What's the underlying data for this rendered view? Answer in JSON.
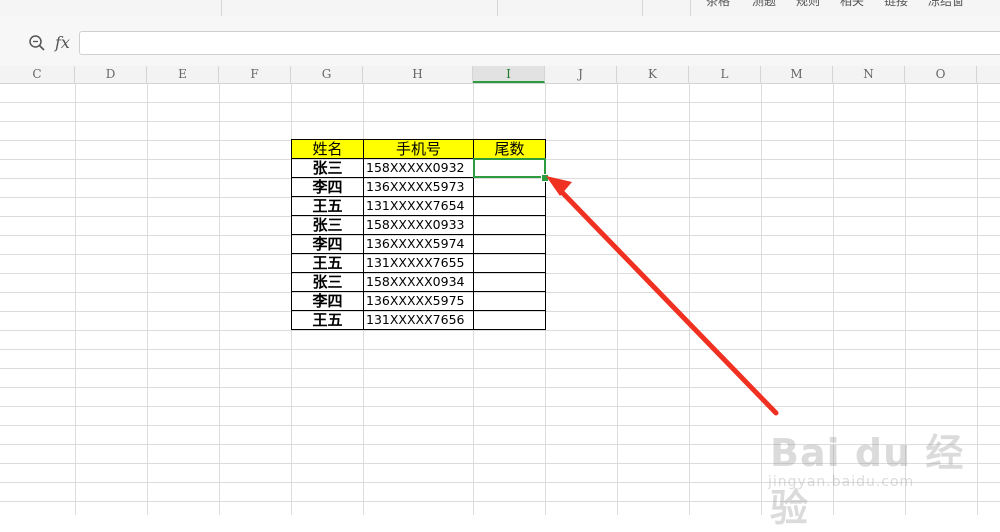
{
  "toolbar": {
    "items": [
      "茶格",
      "测题",
      "规则",
      "相关",
      "链接",
      "冻结窗"
    ]
  },
  "formula_bar": {
    "fx_label": "fx",
    "value": ""
  },
  "columns": [
    "C",
    "D",
    "E",
    "F",
    "G",
    "H",
    "I",
    "J",
    "K",
    "L",
    "M",
    "N",
    "O"
  ],
  "active_column": "I",
  "table": {
    "headers": [
      "姓名",
      "手机号",
      "尾数"
    ],
    "rows": [
      {
        "name": "张三",
        "phone": "158XXXXX0932",
        "tail": ""
      },
      {
        "name": "李四",
        "phone": "136XXXXX5973",
        "tail": ""
      },
      {
        "name": "王五",
        "phone": "131XXXXX7654",
        "tail": ""
      },
      {
        "name": "张三",
        "phone": "158XXXXX0933",
        "tail": ""
      },
      {
        "name": "李四",
        "phone": "136XXXXX5974",
        "tail": ""
      },
      {
        "name": "王五",
        "phone": "131XXXXX7655",
        "tail": ""
      },
      {
        "name": "张三",
        "phone": "158XXXXX0934",
        "tail": ""
      },
      {
        "name": "李四",
        "phone": "136XXXXX5975",
        "tail": ""
      },
      {
        "name": "王五",
        "phone": "131XXXXX7656",
        "tail": ""
      }
    ]
  },
  "selected_cell": "I",
  "colors": {
    "header_fill": "#ffff00",
    "selection": "#2e9b3c",
    "arrow": "#f03020"
  },
  "watermark": {
    "brand": "Bai du 经验",
    "url": "jingyan.baidu.com"
  }
}
